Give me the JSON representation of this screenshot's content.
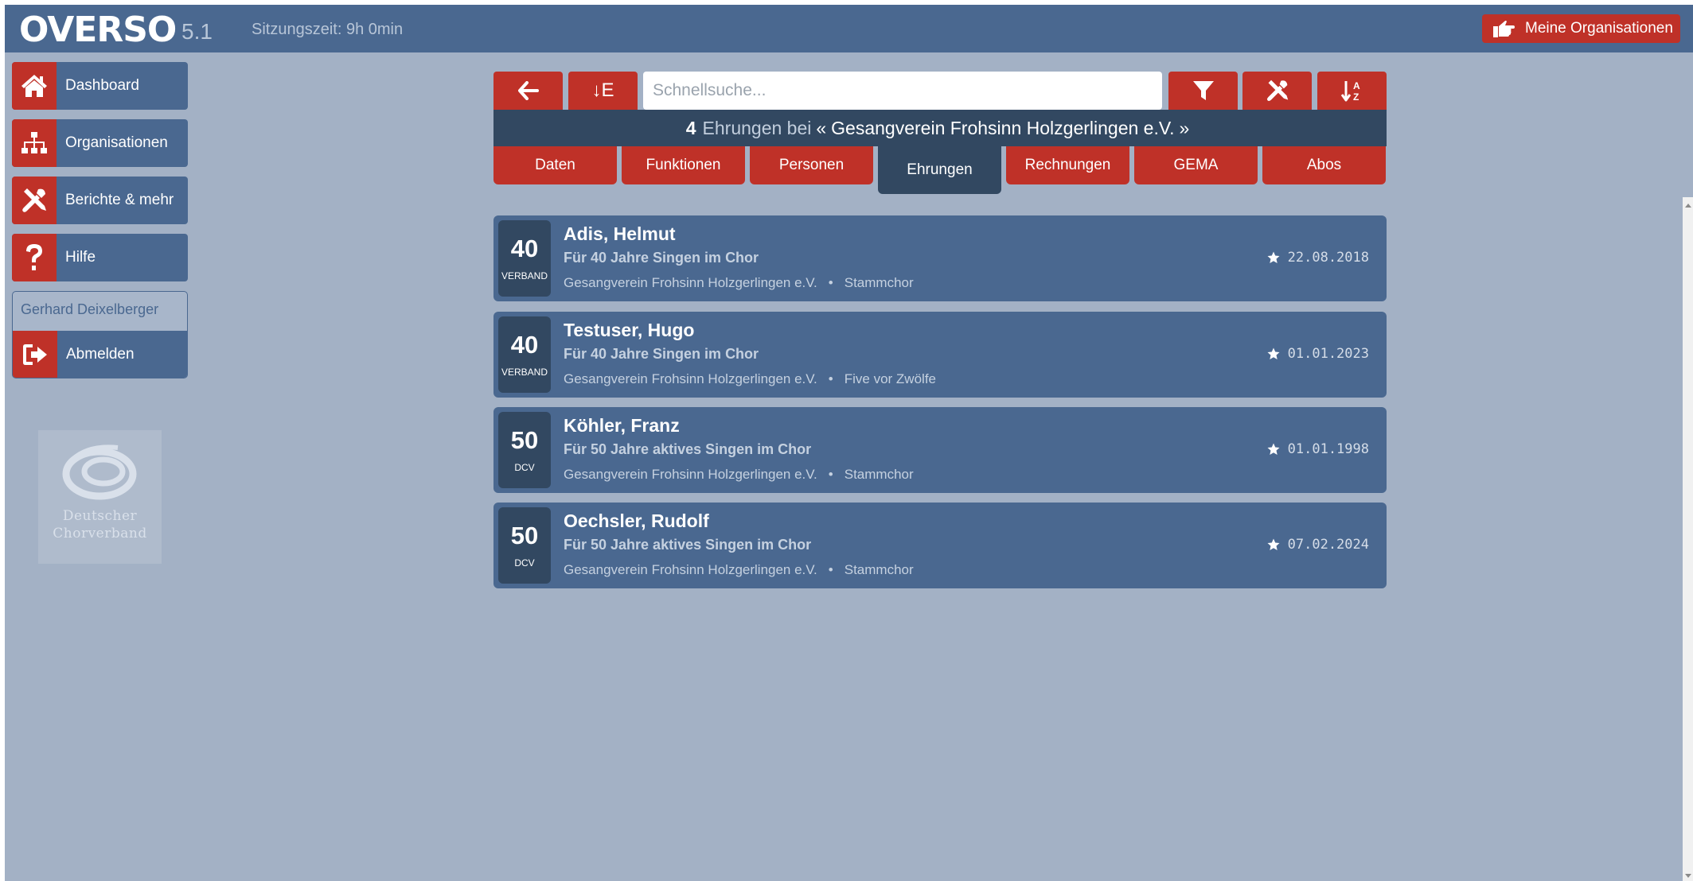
{
  "header": {
    "brand": "OVERSO",
    "version": "5.1",
    "session": "Sitzungszeit: 9h 0min",
    "my_orgs_label": "Meine Organisationen"
  },
  "sidebar": {
    "items": [
      {
        "label": "Dashboard",
        "icon": "home-icon"
      },
      {
        "label": "Organisationen",
        "icon": "sitemap-icon"
      },
      {
        "label": "Berichte & mehr",
        "icon": "tools-icon"
      },
      {
        "label": "Hilfe",
        "icon": "question-icon"
      }
    ],
    "user_name": "Gerhard Deixelberger",
    "logout_label": "Abmelden",
    "logo_line1": "Deutscher",
    "logo_line2": "Chorverband"
  },
  "toolbar": {
    "sort_label": "↓E",
    "search_placeholder": "Schnellsuche..."
  },
  "summary": {
    "count": "4",
    "label": "Ehrungen bei",
    "open_quote": "«",
    "org": "Gesangverein Frohsinn Holzgerlingen e.V.",
    "close_quote": "»"
  },
  "tabs": [
    {
      "label": "Daten"
    },
    {
      "label": "Funktionen"
    },
    {
      "label": "Personen"
    },
    {
      "label": "Ehrungen",
      "active": true
    },
    {
      "label": "Rechnungen"
    },
    {
      "label": "GEMA"
    },
    {
      "label": "Abos"
    }
  ],
  "honors": [
    {
      "years": "40",
      "type": "VERBAND",
      "name": "Adis, Helmut",
      "reason": "Für 40 Jahre Singen im Chor",
      "org": "Gesangverein Frohsinn Holzgerlingen e.V.",
      "sep": "•",
      "choir": "Stammchor",
      "date": "22.08.2018"
    },
    {
      "years": "40",
      "type": "VERBAND",
      "name": "Testuser, Hugo",
      "reason": "Für 40 Jahre Singen im Chor",
      "org": "Gesangverein Frohsinn Holzgerlingen e.V.",
      "sep": "•",
      "choir": "Five vor Zwölfe",
      "date": "01.01.2023"
    },
    {
      "years": "50",
      "type": "DCV",
      "name": "Köhler, Franz",
      "reason": "Für 50 Jahre aktives Singen im Chor",
      "org": "Gesangverein Frohsinn Holzgerlingen e.V.",
      "sep": "•",
      "choir": "Stammchor",
      "date": "01.01.1998"
    },
    {
      "years": "50",
      "type": "DCV",
      "name": "Oechsler, Rudolf",
      "reason": "Für 50 Jahre aktives Singen im Chor",
      "org": "Gesangverein Frohsinn Holzgerlingen e.V.",
      "sep": "•",
      "choir": "Stammchor",
      "date": "07.02.2024"
    }
  ],
  "colors": {
    "accent_red": "#bf3128",
    "panel_blue": "#4a6890",
    "dark_blue": "#324861",
    "background": "#a3b1c5"
  }
}
